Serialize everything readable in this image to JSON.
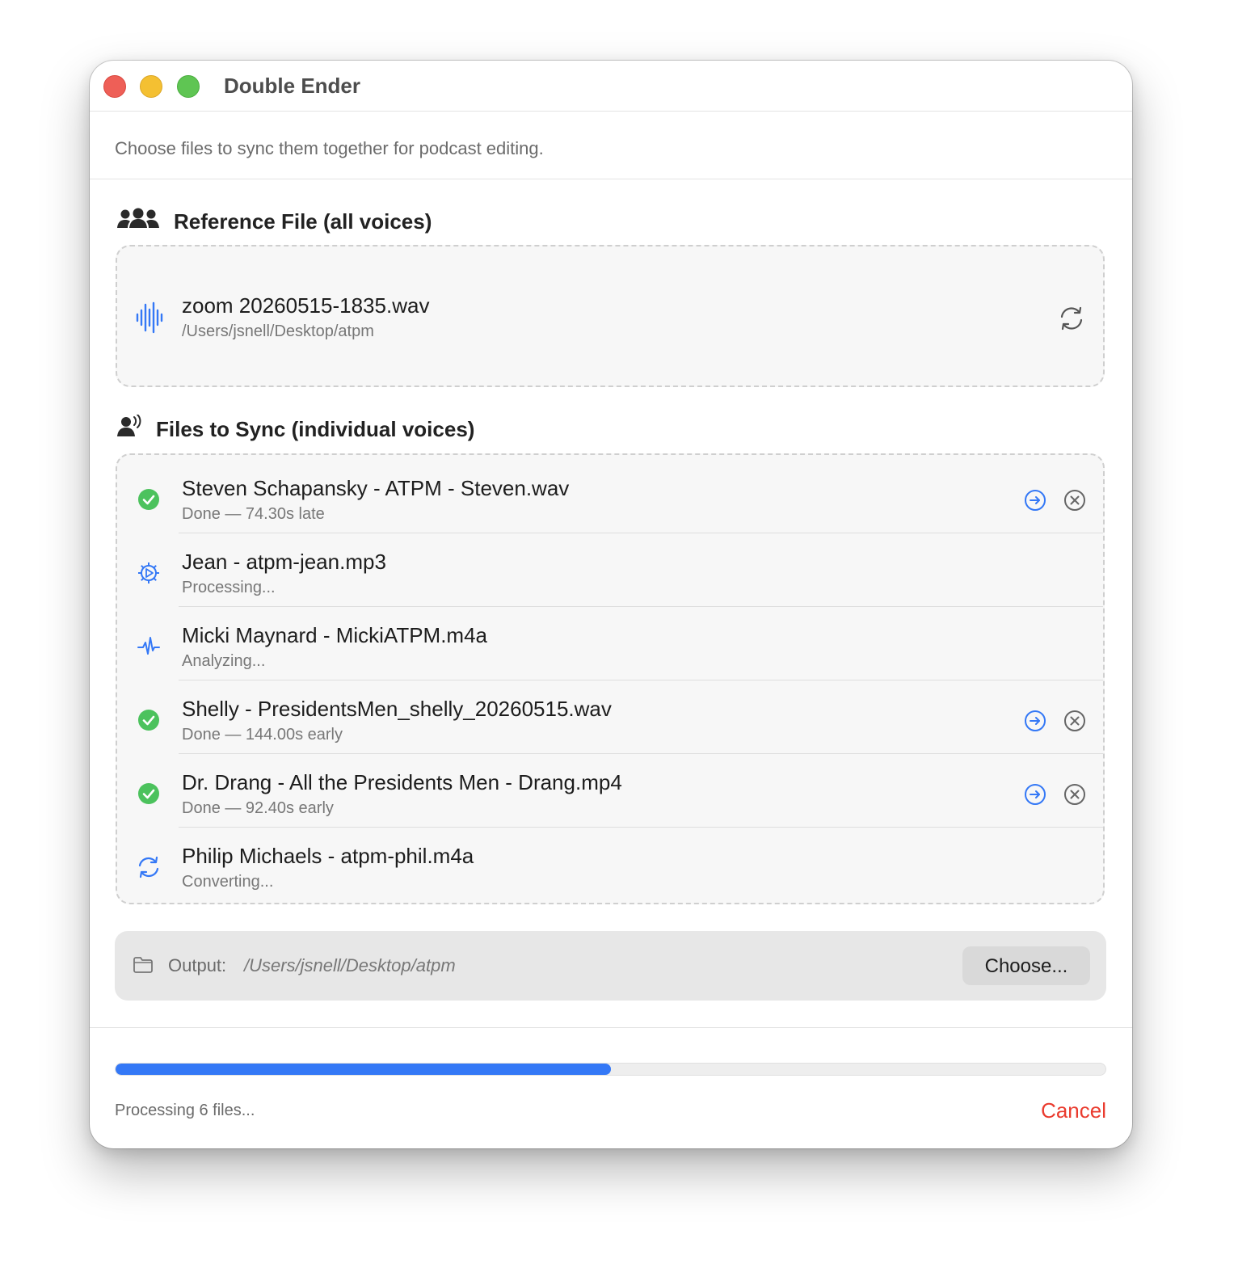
{
  "window": {
    "title": "Double Ender",
    "subtitle": "Choose files to sync them together for podcast editing."
  },
  "reference": {
    "heading": "Reference File (all voices)",
    "icon": "people-group-icon",
    "file_name": "zoom 20260515-1835.wav",
    "file_path": "/Users/jsnell/Desktop/atpm",
    "file_icon": "waveform-icon",
    "action_icon": "replace-arrows-icon"
  },
  "sync": {
    "heading": "Files to Sync (individual voices)",
    "icon": "person-speaking-icon",
    "files": [
      {
        "name": "Steven Schapansky - ATPM - Steven.wav",
        "status": "Done — 74.30s late",
        "state": "done"
      },
      {
        "name": "Jean - atpm-jean.mp3",
        "status": "Processing...",
        "state": "processing"
      },
      {
        "name": "Micki Maynard - MickiATPM.m4a",
        "status": "Analyzing...",
        "state": "analyzing"
      },
      {
        "name": "Shelly - PresidentsMen_shelly_20260515.wav",
        "status": "Done — 144.00s early",
        "state": "done"
      },
      {
        "name": "Dr. Drang - All the Presidents Men - Drang.mp4",
        "status": "Done — 92.40s early",
        "state": "done"
      },
      {
        "name": "Philip Michaels - atpm-phil.m4a",
        "status": "Converting...",
        "state": "converting"
      }
    ]
  },
  "output": {
    "label": "Output:",
    "path": "/Users/jsnell/Desktop/atpm",
    "choose_label": "Choose..."
  },
  "footer": {
    "progress_fraction": 0.5,
    "status_text": "Processing 6 files...",
    "cancel_label": "Cancel"
  },
  "colors": {
    "accent": "#3478f6",
    "success": "#4cc25d",
    "danger": "#ea3b2e",
    "close": "#ee5f57",
    "minimize": "#f4c032",
    "maximize": "#5fc553"
  }
}
